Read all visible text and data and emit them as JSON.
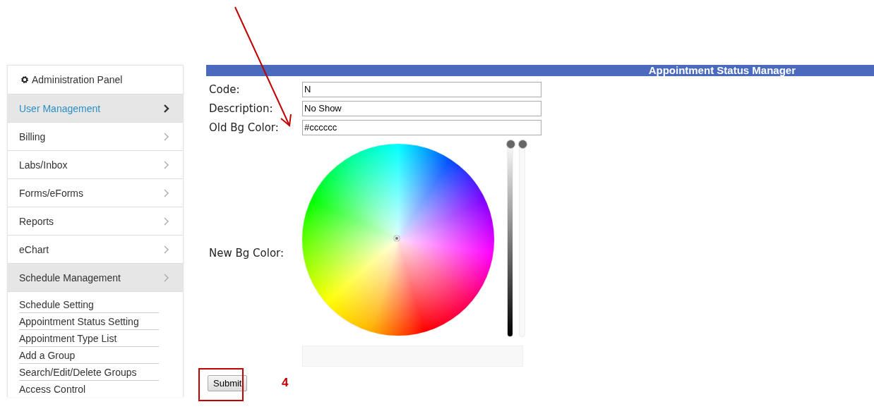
{
  "sidebar": {
    "title": "Administration Panel",
    "items": [
      {
        "label": "User Management",
        "selected": true,
        "expanded": false
      },
      {
        "label": "Billing",
        "selected": false,
        "expanded": false
      },
      {
        "label": "Labs/Inbox",
        "selected": false,
        "expanded": false
      },
      {
        "label": "Forms/eForms",
        "selected": false,
        "expanded": false
      },
      {
        "label": "Reports",
        "selected": false,
        "expanded": false
      },
      {
        "label": "eChart",
        "selected": false,
        "expanded": false
      },
      {
        "label": "Schedule Management",
        "selected": false,
        "expanded": true,
        "children": [
          {
            "label": "Schedule Setting"
          },
          {
            "label": "Appointment Status Setting"
          },
          {
            "label": "Appointment Type List"
          },
          {
            "label": "Add a Group"
          },
          {
            "label": "Search/Edit/Delete Groups"
          },
          {
            "label": "Access Control"
          }
        ]
      }
    ]
  },
  "page": {
    "title": "Appointment Status Manager",
    "fields": [
      {
        "label": "Code:",
        "value": "N"
      },
      {
        "label": "Description:",
        "value": "No Show"
      },
      {
        "label": "Old Bg Color:",
        "value": "#cccccc"
      }
    ],
    "picker": {
      "label": "New Bg Color:",
      "brightness": {
        "level": 1
      },
      "opacity": {
        "level": 1
      }
    },
    "submit": "Submit"
  },
  "annotation": {
    "step": "4"
  }
}
